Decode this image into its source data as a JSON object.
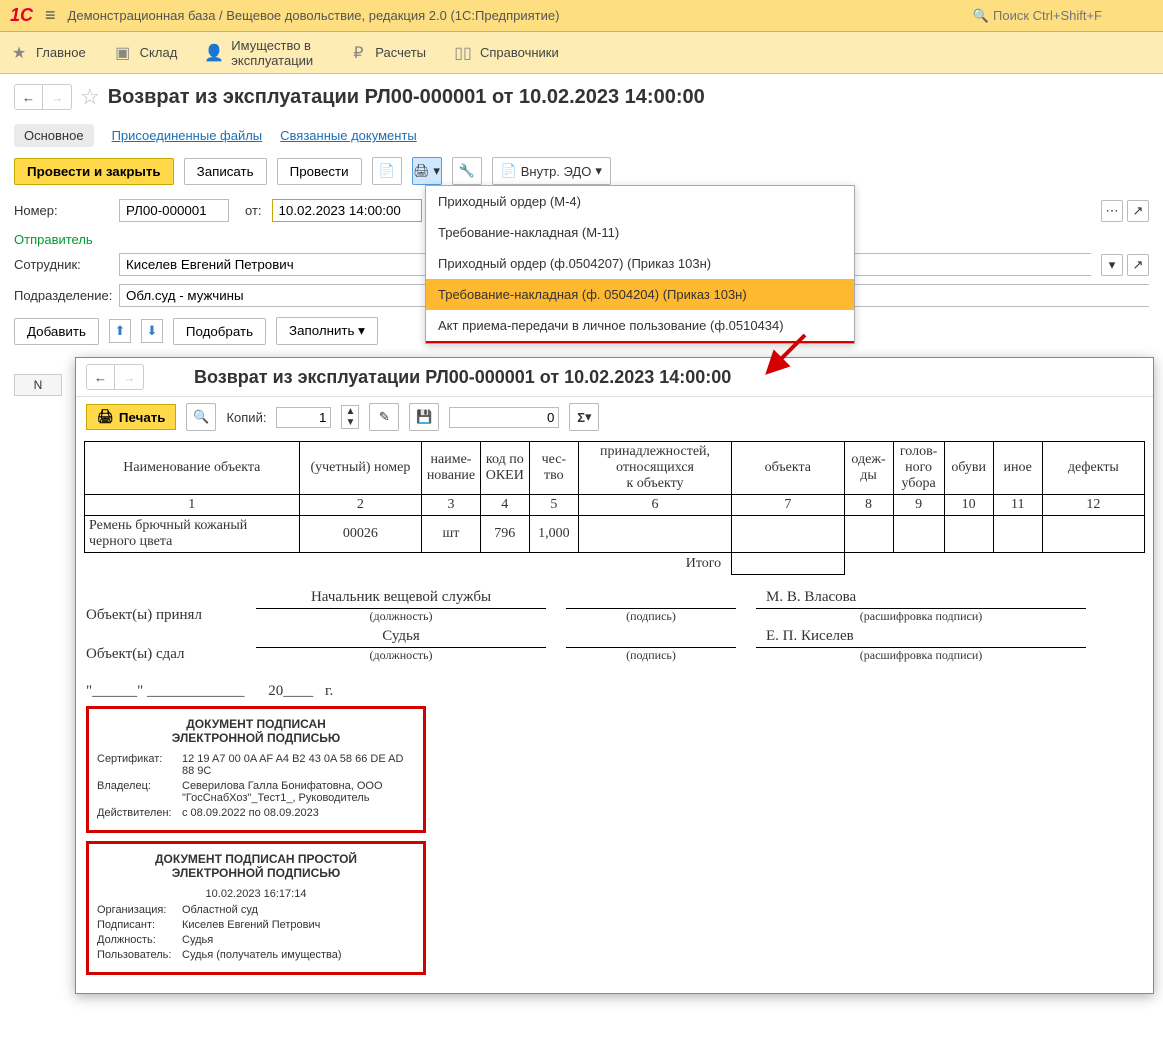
{
  "app": {
    "title": "Демонстрационная база / Вещевое довольствие, редакция 2.0  (1С:Предприятие)",
    "search_placeholder": "Поиск Ctrl+Shift+F"
  },
  "mainmenu": {
    "items": [
      "Главное",
      "Склад",
      "Имущество в эксплуатации",
      "Расчеты",
      "Справочники"
    ]
  },
  "doc": {
    "title": "Возврат из эксплуатации РЛ00-000001 от 10.02.2023 14:00:00",
    "tab_main": "Основное",
    "tab_files": "Присоединенные файлы",
    "tab_links": "Связанные документы"
  },
  "toolbar": {
    "post_close": "Провести и закрыть",
    "write": "Записать",
    "post": "Провести",
    "vedo": "Внутр. ЭДО"
  },
  "print_menu": {
    "items": [
      "Приходный ордер (М-4)",
      "Требование-накладная (М-11)",
      "Приходный ордер (ф.0504207) (Приказ 103н)",
      "Требование-накладная (ф. 0504204) (Приказ 103н)",
      "Акт приема-передачи в личное пользование (ф.0510434)"
    ]
  },
  "form": {
    "number_label": "Номер:",
    "number": "РЛ00-000001",
    "from_label": "от:",
    "date": "10.02.2023 14:00:00",
    "sender_title": "Отправитель",
    "employee_label": "Сотрудник:",
    "employee": "Киселев Евгений Петрович",
    "dept_label": "Подразделение:",
    "dept": "Обл.суд - мужчины",
    "add": "Добавить",
    "pick": "Подобрать",
    "fill": "Заполнить",
    "n_col": "N"
  },
  "preview": {
    "title": "Возврат из эксплуатации РЛ00-000001 от 10.02.2023 14:00:00",
    "print": "Печать",
    "copies_label": "Копий:",
    "copies": "1",
    "sum": "0",
    "headers": {
      "h1": "Наименование объекта",
      "h2a": "(учетный) номер",
      "h3a": "наиме-",
      "h3b": "нование",
      "h4a": "код по",
      "h4b": "ОКЕИ",
      "h5a": "чес-",
      "h5b": "тво",
      "h6a": "принадлежностей,",
      "h6b": "относящихся",
      "h6c": "к объекту",
      "h7": "объекта",
      "h8a": "одеж-",
      "h8b": "ды",
      "h9a": "голов-",
      "h9b": "ного",
      "h9c": "убора",
      "h10": "обуви",
      "h11": "иное",
      "h12": "дефекты"
    },
    "nums": {
      "c1": "1",
      "c2": "2",
      "c3": "3",
      "c4": "4",
      "c5": "5",
      "c6": "6",
      "c7": "7",
      "c8": "8",
      "c9": "9",
      "c10": "10",
      "c11": "11",
      "c12": "12"
    },
    "row": {
      "name": "Ремень брючный кожаный черного цвета",
      "code": "00026",
      "unit": "шт",
      "okei": "796",
      "qty": "1,000"
    },
    "itogo": "Итого",
    "sig": {
      "received_label": "Объект(ы) принял",
      "received_pos": "Начальник вещевой службы",
      "received_name": "М. В. Власова",
      "gave_label": "Объект(ы) сдал",
      "gave_pos": "Судья",
      "gave_name": "Е. П. Киселев",
      "cap_pos": "(должность)",
      "cap_sign": "(подпись)",
      "cap_name": "(расшифровка подписи)"
    },
    "date_line": {
      "p1": "\"______\"",
      "p2": "_____________",
      "p3": "20____",
      "p4": "г."
    },
    "stamp1": {
      "title1": "ДОКУМЕНТ ПОДПИСАН",
      "title2": "ЭЛЕКТРОННОЙ ПОДПИСЬЮ",
      "cert_k": "Сертификат:",
      "cert_v": "12 19 A7 00 0A AF A4 B2 43 0A 58 66 DE AD 88 9C",
      "owner_k": "Владелец:",
      "owner_v": "Северилова Галла Бонифатовна, ООО \"ГосСнабХоз\"_Тест1_, Руководитель",
      "valid_k": "Действителен:",
      "valid_v": "с 08.09.2022 по 08.09.2023"
    },
    "stamp2": {
      "title1": "ДОКУМЕНТ ПОДПИСАН ПРОСТОЙ",
      "title2": "ЭЛЕКТРОННОЙ ПОДПИСЬЮ",
      "ts": "10.02.2023 16:17:14",
      "org_k": "Организация:",
      "org_v": "Областной суд",
      "signer_k": "Подписант:",
      "signer_v": "Киселев Евгений Петрович",
      "pos_k": "Должность:",
      "pos_v": "Судья",
      "user_k": "Пользователь:",
      "user_v": "Судья (получатель имущества)"
    }
  }
}
